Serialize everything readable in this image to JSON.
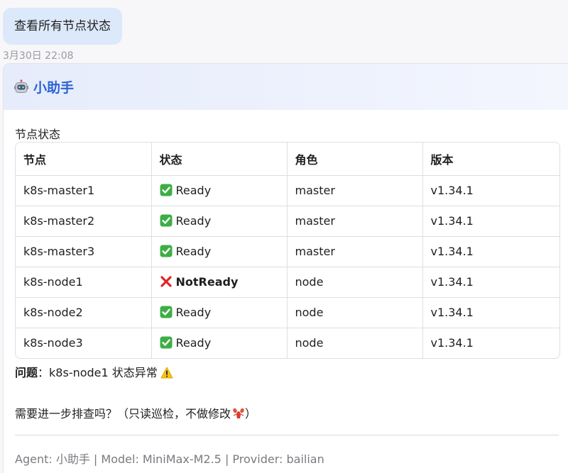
{
  "user_message": {
    "text": "查看所有节点状态",
    "timestamp": "3月30日 22:08"
  },
  "assistant": {
    "icon": "robot-icon",
    "name": "小助手",
    "section_title": "节点状态",
    "table": {
      "headers": [
        "节点",
        "状态",
        "角色",
        "版本"
      ],
      "rows": [
        {
          "node": "k8s-master1",
          "status": "Ready",
          "status_icon": "check-icon",
          "role": "master",
          "version": "v1.34.1"
        },
        {
          "node": "k8s-master2",
          "status": "Ready",
          "status_icon": "check-icon",
          "role": "master",
          "version": "v1.34.1"
        },
        {
          "node": "k8s-master3",
          "status": "Ready",
          "status_icon": "check-icon",
          "role": "master",
          "version": "v1.34.1"
        },
        {
          "node": "k8s-node1",
          "status": "NotReady",
          "status_icon": "cross-icon",
          "role": "node",
          "version": "v1.34.1"
        },
        {
          "node": "k8s-node2",
          "status": "Ready",
          "status_icon": "check-icon",
          "role": "node",
          "version": "v1.34.1"
        },
        {
          "node": "k8s-node3",
          "status": "Ready",
          "status_icon": "check-icon",
          "role": "node",
          "version": "v1.34.1"
        }
      ]
    },
    "issue": {
      "label": "问题",
      "separator": "：",
      "text": "k8s-node1 状态异常",
      "icon": "warning-icon"
    },
    "followup": {
      "text": "需要进一步排查吗？（只读巡检，不做修改",
      "icon": "lobster-icon",
      "suffix": "）"
    },
    "footer": "Agent: 小助手 | Model: MiniMax-M2.5 | Provider: bailian"
  },
  "colors": {
    "user_bubble": "#dce9fb",
    "assistant_name": "#2c63d4",
    "check_green": "#3dae45",
    "cross_red": "#e02424",
    "warning_yellow": "#f5c518"
  }
}
